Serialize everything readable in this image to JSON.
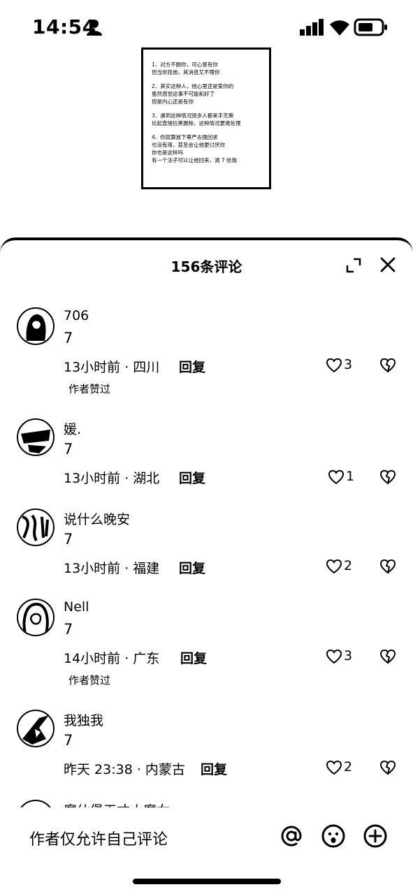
{
  "status_bar": {
    "time": "14:54"
  },
  "article": {
    "paragraphs": [
      "1、对方不删你，可心里有你\n但当你找他，其消息又不理你",
      "2、其实这种人，他心里还是爱你的\n虽然感觉这事不可能和好了\n但是内心还是有你",
      "3、遇到这种情况很多人都束手无策\n比起直接拉黑删除，这种情况更难处理",
      "4、你就算放下尊严去挽回求\n也没有用，甚至会让他更讨厌你\n你也是这样吗\n有一个法子可以让他回来，滴 7 给我"
    ]
  },
  "sheet": {
    "title": "156条评论"
  },
  "comments": [
    {
      "user": "706",
      "text": "7",
      "meta": "13小时前 · 四川",
      "reply": "回复",
      "likes": "3",
      "liked_by_author": "作者赞过"
    },
    {
      "user": "媛.",
      "text": "7",
      "meta": "13小时前 · 湖北",
      "reply": "回复",
      "likes": "1",
      "liked_by_author": ""
    },
    {
      "user": "说什么晚安",
      "text": "7",
      "meta": "13小时前 · 福建",
      "reply": "回复",
      "likes": "2",
      "liked_by_author": ""
    },
    {
      "user": "Nell",
      "text": "7",
      "meta": "14小时前 · 广东",
      "reply": "回复",
      "likes": "3",
      "liked_by_author": "作者赞过"
    },
    {
      "user": "我独我",
      "text": "7",
      "meta": "昨天 23:38 · 内蒙古",
      "reply": "回复",
      "likes": "2",
      "liked_by_author": ""
    },
    {
      "user": "魔仙堡天才小魔女",
      "text": "",
      "meta": "",
      "reply": "",
      "likes": "",
      "liked_by_author": ""
    }
  ],
  "input_bar": {
    "placeholder": "作者仅允许自己评论"
  },
  "icons": [
    "person-icon",
    "signal-icon",
    "wifi-icon",
    "battery-icon",
    "expand-icon",
    "close-icon",
    "heart-icon",
    "broken-heart-icon",
    "at-icon",
    "emoji-icon",
    "plus-icon"
  ]
}
